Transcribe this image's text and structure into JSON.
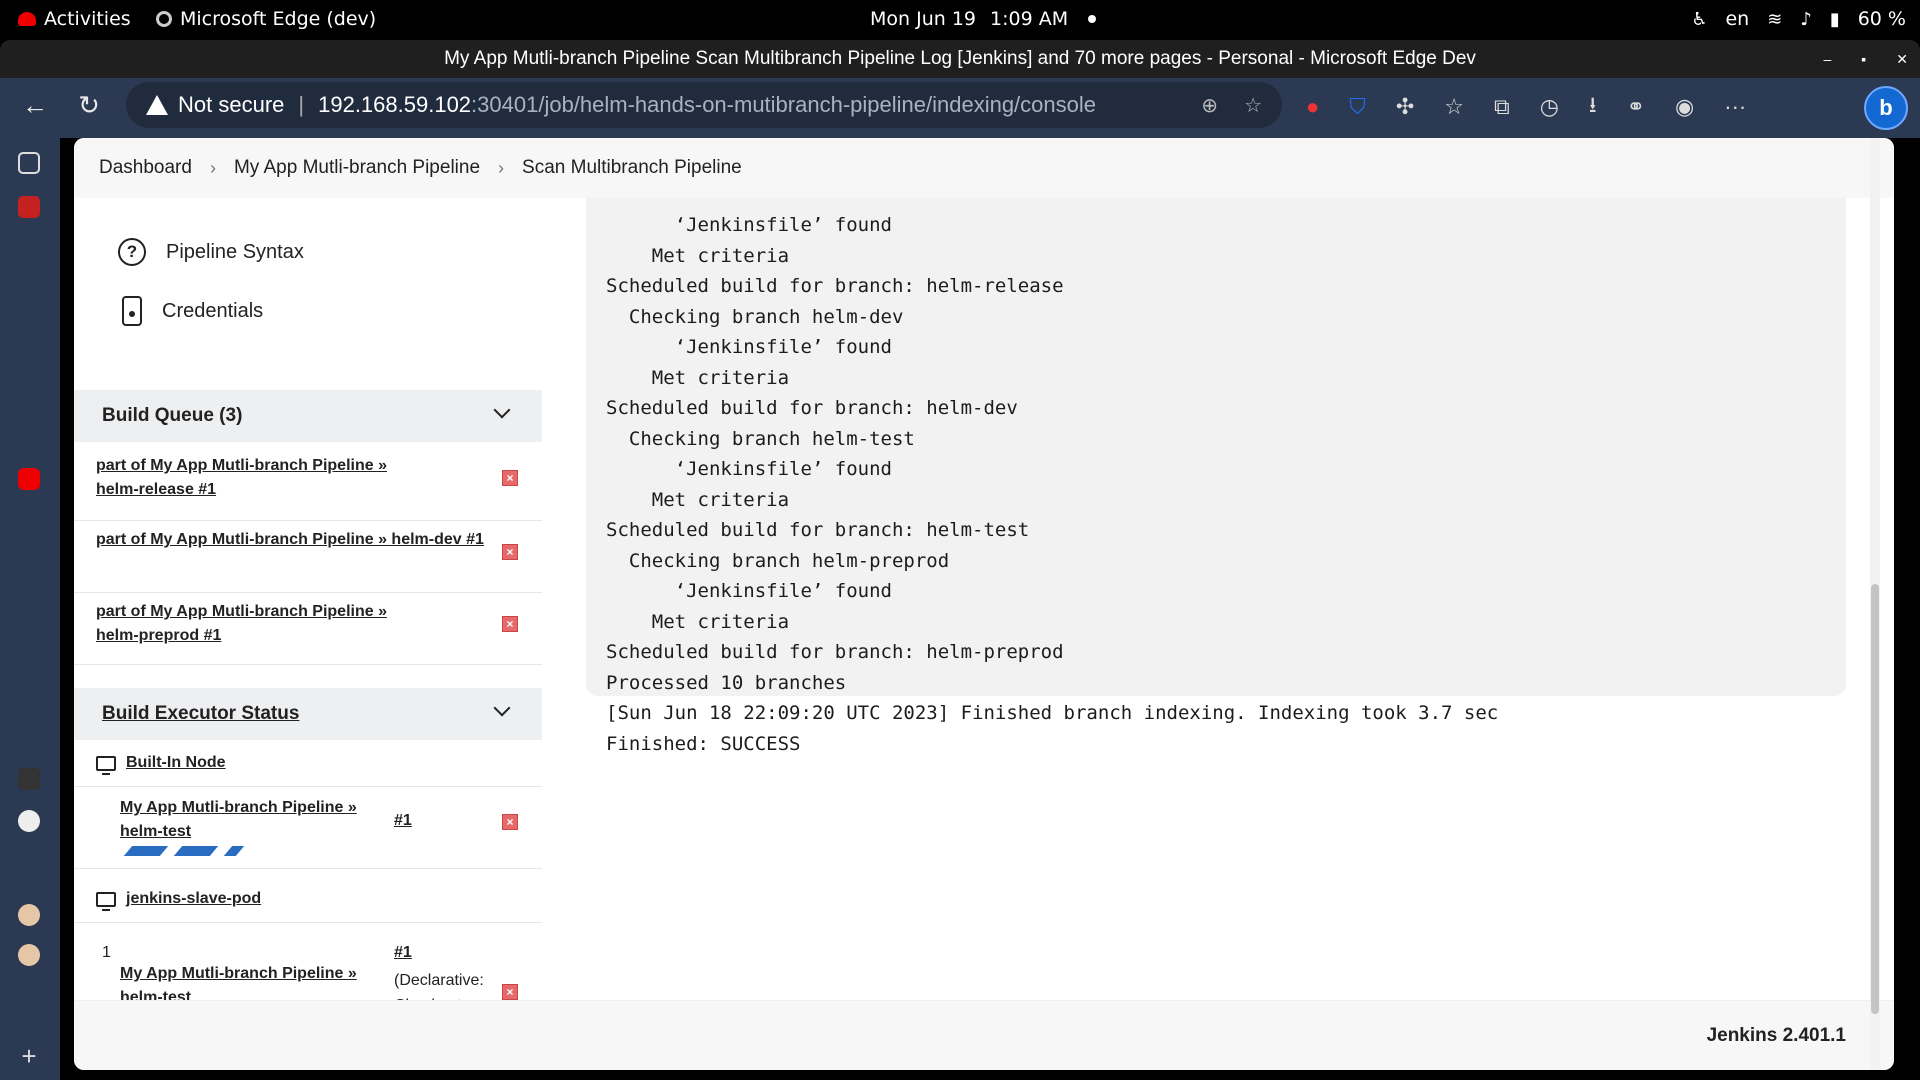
{
  "system_bar": {
    "activities": "Activities",
    "app_name": "Microsoft Edge (dev)",
    "date": "Mon Jun 19",
    "time": "1:09 AM",
    "lang": "en",
    "battery": "60 %"
  },
  "window": {
    "title": "My App Mutli-branch Pipeline Scan Multibranch Pipeline Log [Jenkins] and 70 more pages - Personal - Microsoft Edge Dev"
  },
  "address": {
    "security": "Not secure",
    "host": "192.168.59.102",
    "path": ":30401/job/helm-hands-on-mutibranch-pipeline/indexing/console"
  },
  "breadcrumb": {
    "items": [
      "Dashboard",
      "My App Mutli-branch Pipeline",
      "Scan Multibranch Pipeline"
    ]
  },
  "side_links": {
    "pipeline_syntax": "Pipeline Syntax",
    "credentials": "Credentials"
  },
  "build_queue": {
    "title": "Build Queue (3)",
    "items": [
      "part of My App Mutli-branch Pipeline » helm-release #1",
      "part of My App Mutli-branch Pipeline » helm-dev #1",
      "part of My App Mutli-branch Pipeline » helm-preprod #1"
    ]
  },
  "executors": {
    "title": "Build Executor Status",
    "nodes": [
      {
        "name": "Built-In Node",
        "job": "My App Mutli-branch Pipeline » helm-test",
        "build": "#1"
      },
      {
        "name": "jenkins-slave-pod",
        "index": "1",
        "job": "My App Mutli-branch Pipeline » helm-test",
        "build": "#1",
        "detail": "(Declarative: Checkout SCM)"
      }
    ]
  },
  "console": {
    "lines": [
      "      ‘Jenkinsfile’ found",
      "    Met criteria",
      "Scheduled build for branch: helm-release",
      "  Checking branch helm-dev",
      "      ‘Jenkinsfile’ found",
      "    Met criteria",
      "Scheduled build for branch: helm-dev",
      "  Checking branch helm-test",
      "      ‘Jenkinsfile’ found",
      "    Met criteria",
      "Scheduled build for branch: helm-test",
      "  Checking branch helm-preprod",
      "      ‘Jenkinsfile’ found",
      "    Met criteria",
      "Scheduled build for branch: helm-preprod",
      "Processed 10 branches",
      "[Sun Jun 18 22:09:20 UTC 2023] Finished branch indexing. Indexing took 3.7 sec",
      "Finished: SUCCESS"
    ]
  },
  "footer": {
    "version": "Jenkins 2.401.1"
  },
  "colors": {
    "toolbar": "#2b3a52",
    "progress": "#2a6cc0",
    "cancel": "#e76a6a"
  }
}
